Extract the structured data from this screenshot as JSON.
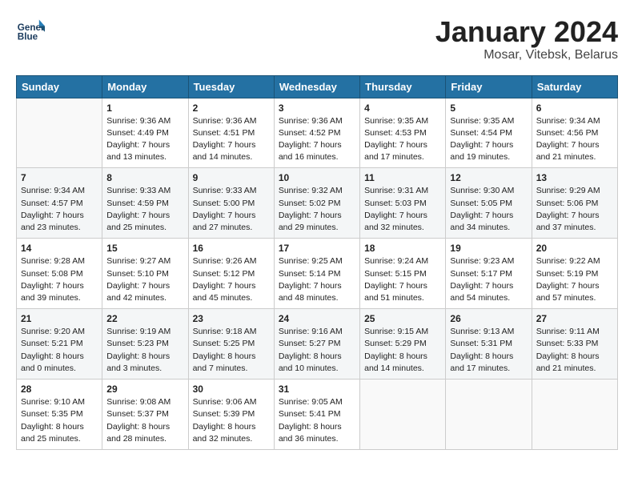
{
  "header": {
    "logo_line1": "General",
    "logo_line2": "Blue",
    "month": "January 2024",
    "location": "Mosar, Vitebsk, Belarus"
  },
  "weekdays": [
    "Sunday",
    "Monday",
    "Tuesday",
    "Wednesday",
    "Thursday",
    "Friday",
    "Saturday"
  ],
  "weeks": [
    [
      {
        "day": "",
        "sunrise": "",
        "sunset": "",
        "daylight": ""
      },
      {
        "day": "1",
        "sunrise": "Sunrise: 9:36 AM",
        "sunset": "Sunset: 4:49 PM",
        "daylight": "Daylight: 7 hours and 13 minutes."
      },
      {
        "day": "2",
        "sunrise": "Sunrise: 9:36 AM",
        "sunset": "Sunset: 4:51 PM",
        "daylight": "Daylight: 7 hours and 14 minutes."
      },
      {
        "day": "3",
        "sunrise": "Sunrise: 9:36 AM",
        "sunset": "Sunset: 4:52 PM",
        "daylight": "Daylight: 7 hours and 16 minutes."
      },
      {
        "day": "4",
        "sunrise": "Sunrise: 9:35 AM",
        "sunset": "Sunset: 4:53 PM",
        "daylight": "Daylight: 7 hours and 17 minutes."
      },
      {
        "day": "5",
        "sunrise": "Sunrise: 9:35 AM",
        "sunset": "Sunset: 4:54 PM",
        "daylight": "Daylight: 7 hours and 19 minutes."
      },
      {
        "day": "6",
        "sunrise": "Sunrise: 9:34 AM",
        "sunset": "Sunset: 4:56 PM",
        "daylight": "Daylight: 7 hours and 21 minutes."
      }
    ],
    [
      {
        "day": "7",
        "sunrise": "Sunrise: 9:34 AM",
        "sunset": "Sunset: 4:57 PM",
        "daylight": "Daylight: 7 hours and 23 minutes."
      },
      {
        "day": "8",
        "sunrise": "Sunrise: 9:33 AM",
        "sunset": "Sunset: 4:59 PM",
        "daylight": "Daylight: 7 hours and 25 minutes."
      },
      {
        "day": "9",
        "sunrise": "Sunrise: 9:33 AM",
        "sunset": "Sunset: 5:00 PM",
        "daylight": "Daylight: 7 hours and 27 minutes."
      },
      {
        "day": "10",
        "sunrise": "Sunrise: 9:32 AM",
        "sunset": "Sunset: 5:02 PM",
        "daylight": "Daylight: 7 hours and 29 minutes."
      },
      {
        "day": "11",
        "sunrise": "Sunrise: 9:31 AM",
        "sunset": "Sunset: 5:03 PM",
        "daylight": "Daylight: 7 hours and 32 minutes."
      },
      {
        "day": "12",
        "sunrise": "Sunrise: 9:30 AM",
        "sunset": "Sunset: 5:05 PM",
        "daylight": "Daylight: 7 hours and 34 minutes."
      },
      {
        "day": "13",
        "sunrise": "Sunrise: 9:29 AM",
        "sunset": "Sunset: 5:06 PM",
        "daylight": "Daylight: 7 hours and 37 minutes."
      }
    ],
    [
      {
        "day": "14",
        "sunrise": "Sunrise: 9:28 AM",
        "sunset": "Sunset: 5:08 PM",
        "daylight": "Daylight: 7 hours and 39 minutes."
      },
      {
        "day": "15",
        "sunrise": "Sunrise: 9:27 AM",
        "sunset": "Sunset: 5:10 PM",
        "daylight": "Daylight: 7 hours and 42 minutes."
      },
      {
        "day": "16",
        "sunrise": "Sunrise: 9:26 AM",
        "sunset": "Sunset: 5:12 PM",
        "daylight": "Daylight: 7 hours and 45 minutes."
      },
      {
        "day": "17",
        "sunrise": "Sunrise: 9:25 AM",
        "sunset": "Sunset: 5:14 PM",
        "daylight": "Daylight: 7 hours and 48 minutes."
      },
      {
        "day": "18",
        "sunrise": "Sunrise: 9:24 AM",
        "sunset": "Sunset: 5:15 PM",
        "daylight": "Daylight: 7 hours and 51 minutes."
      },
      {
        "day": "19",
        "sunrise": "Sunrise: 9:23 AM",
        "sunset": "Sunset: 5:17 PM",
        "daylight": "Daylight: 7 hours and 54 minutes."
      },
      {
        "day": "20",
        "sunrise": "Sunrise: 9:22 AM",
        "sunset": "Sunset: 5:19 PM",
        "daylight": "Daylight: 7 hours and 57 minutes."
      }
    ],
    [
      {
        "day": "21",
        "sunrise": "Sunrise: 9:20 AM",
        "sunset": "Sunset: 5:21 PM",
        "daylight": "Daylight: 8 hours and 0 minutes."
      },
      {
        "day": "22",
        "sunrise": "Sunrise: 9:19 AM",
        "sunset": "Sunset: 5:23 PM",
        "daylight": "Daylight: 8 hours and 3 minutes."
      },
      {
        "day": "23",
        "sunrise": "Sunrise: 9:18 AM",
        "sunset": "Sunset: 5:25 PM",
        "daylight": "Daylight: 8 hours and 7 minutes."
      },
      {
        "day": "24",
        "sunrise": "Sunrise: 9:16 AM",
        "sunset": "Sunset: 5:27 PM",
        "daylight": "Daylight: 8 hours and 10 minutes."
      },
      {
        "day": "25",
        "sunrise": "Sunrise: 9:15 AM",
        "sunset": "Sunset: 5:29 PM",
        "daylight": "Daylight: 8 hours and 14 minutes."
      },
      {
        "day": "26",
        "sunrise": "Sunrise: 9:13 AM",
        "sunset": "Sunset: 5:31 PM",
        "daylight": "Daylight: 8 hours and 17 minutes."
      },
      {
        "day": "27",
        "sunrise": "Sunrise: 9:11 AM",
        "sunset": "Sunset: 5:33 PM",
        "daylight": "Daylight: 8 hours and 21 minutes."
      }
    ],
    [
      {
        "day": "28",
        "sunrise": "Sunrise: 9:10 AM",
        "sunset": "Sunset: 5:35 PM",
        "daylight": "Daylight: 8 hours and 25 minutes."
      },
      {
        "day": "29",
        "sunrise": "Sunrise: 9:08 AM",
        "sunset": "Sunset: 5:37 PM",
        "daylight": "Daylight: 8 hours and 28 minutes."
      },
      {
        "day": "30",
        "sunrise": "Sunrise: 9:06 AM",
        "sunset": "Sunset: 5:39 PM",
        "daylight": "Daylight: 8 hours and 32 minutes."
      },
      {
        "day": "31",
        "sunrise": "Sunrise: 9:05 AM",
        "sunset": "Sunset: 5:41 PM",
        "daylight": "Daylight: 8 hours and 36 minutes."
      },
      {
        "day": "",
        "sunrise": "",
        "sunset": "",
        "daylight": ""
      },
      {
        "day": "",
        "sunrise": "",
        "sunset": "",
        "daylight": ""
      },
      {
        "day": "",
        "sunrise": "",
        "sunset": "",
        "daylight": ""
      }
    ]
  ]
}
